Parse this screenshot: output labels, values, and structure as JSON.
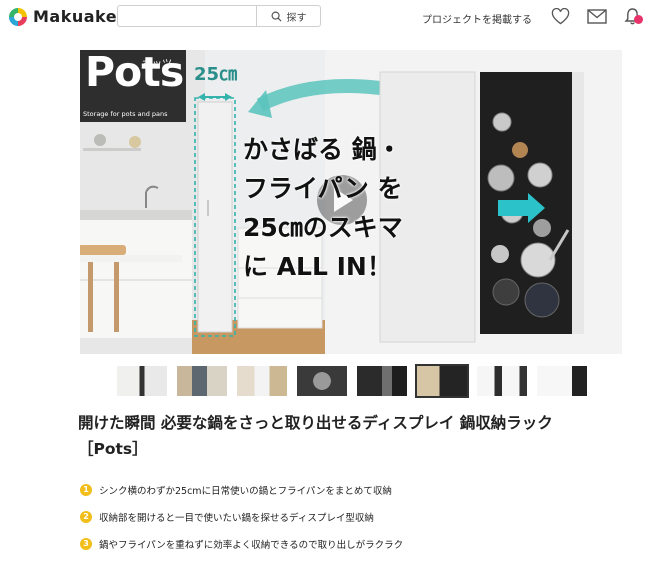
{
  "header": {
    "brand": "Makuake",
    "search_placeholder": "",
    "search_label": "探す",
    "post_project": "プロジェクトを掲載する"
  },
  "hero": {
    "logo_word": "Pots",
    "logo_kana": "ポッツ",
    "logo_tagline": "Storage for pots and pans",
    "width_label": "25",
    "width_unit": "㎝",
    "headline": [
      "かさばる 鍋・",
      "フライパン を",
      "25㎝のスキマ",
      "に ALL IN！"
    ]
  },
  "thumbnails": [
    {
      "active": false
    },
    {
      "active": false
    },
    {
      "active": false
    },
    {
      "active": false
    },
    {
      "active": false
    },
    {
      "active": true
    },
    {
      "active": false
    },
    {
      "active": false
    }
  ],
  "title": "開けた瞬間 必要な鍋をさっと取り出せるディスプレイ 鍋収納ラック ［Pots］",
  "points": [
    {
      "num": "1",
      "text": "シンク横のわずか25cmに日常使いの鍋とフライパンをまとめて収納"
    },
    {
      "num": "2",
      "text": "収納部を開けると一目で使いたい鍋を探せるディスプレイ型収納"
    },
    {
      "num": "3",
      "text": "鍋やフライパンを重ねずに効率よく収納できるので取り出しがラクラク"
    }
  ],
  "colors": {
    "accent": "#f2be1a",
    "notification": "#e8336a",
    "teal": "#33b3ac"
  }
}
